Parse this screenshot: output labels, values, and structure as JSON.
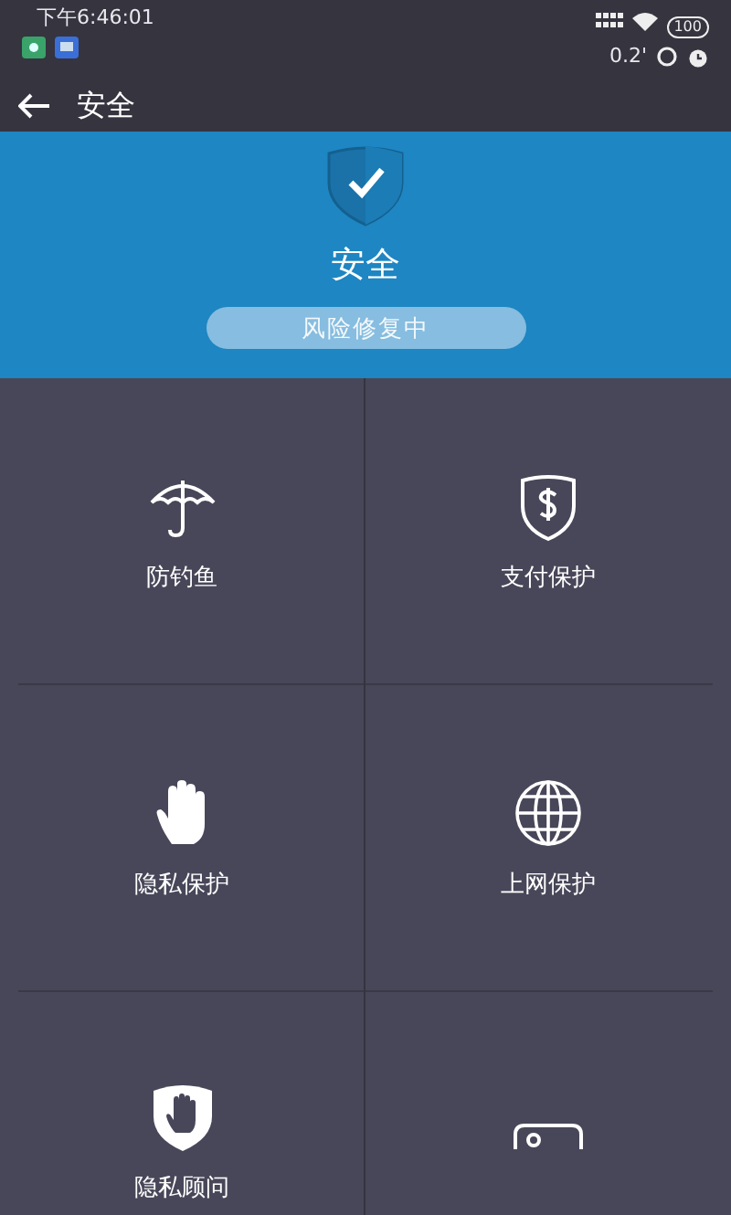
{
  "status_bar": {
    "time": "下午6:46:01",
    "speed": "0.2'",
    "battery": "100"
  },
  "header": {
    "title": "安全"
  },
  "banner": {
    "title": "安全",
    "status": "风险修复中"
  },
  "tiles": [
    {
      "label": "防钓鱼"
    },
    {
      "label": "支付保护"
    },
    {
      "label": "隐私保护"
    },
    {
      "label": "上网保护"
    },
    {
      "label": "隐私顾问"
    }
  ]
}
